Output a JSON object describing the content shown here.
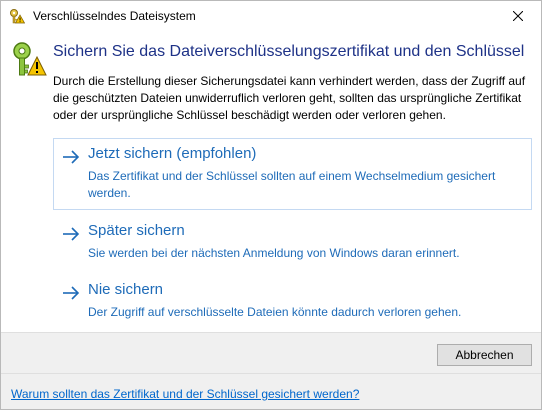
{
  "window": {
    "title": "Verschlüsselndes Dateisystem"
  },
  "header": {
    "title": "Sichern Sie das Dateiverschlüsselungszertifikat und den Schlüssel",
    "description": "Durch die Erstellung dieser Sicherungsdatei kann verhindert werden, dass der Zugriff auf die geschützten Dateien unwiderruflich verloren geht, sollten das ursprüngliche Zertifikat oder der ursprüngliche Schlüssel beschädigt werden oder verloren gehen."
  },
  "options": [
    {
      "title": "Jetzt sichern (empfohlen)",
      "description": "Das Zertifikat und der Schlüssel sollten auf einem Wechselmedium gesichert werden."
    },
    {
      "title": "Später sichern",
      "description": "Sie werden bei der nächsten Anmeldung von Windows daran erinnert."
    },
    {
      "title": "Nie sichern",
      "description": "Der Zugriff auf verschlüsselte Dateien könnte dadurch verloren gehen."
    }
  ],
  "footer": {
    "cancel_label": "Abbrechen",
    "help_link": "Warum sollten das Zertifikat und der Schlüssel gesichert werden?"
  },
  "icons": {
    "title": "key-warning-icon",
    "header": "key-warning-icon",
    "option_arrow": "arrow-right-icon",
    "close": "close-icon"
  },
  "colors": {
    "header_title": "#1e3287",
    "command_link": "#1e6bb8",
    "hyperlink": "#0066cc",
    "footer_bg": "#f0f0f0",
    "selected_border": "#c4d9f2"
  }
}
